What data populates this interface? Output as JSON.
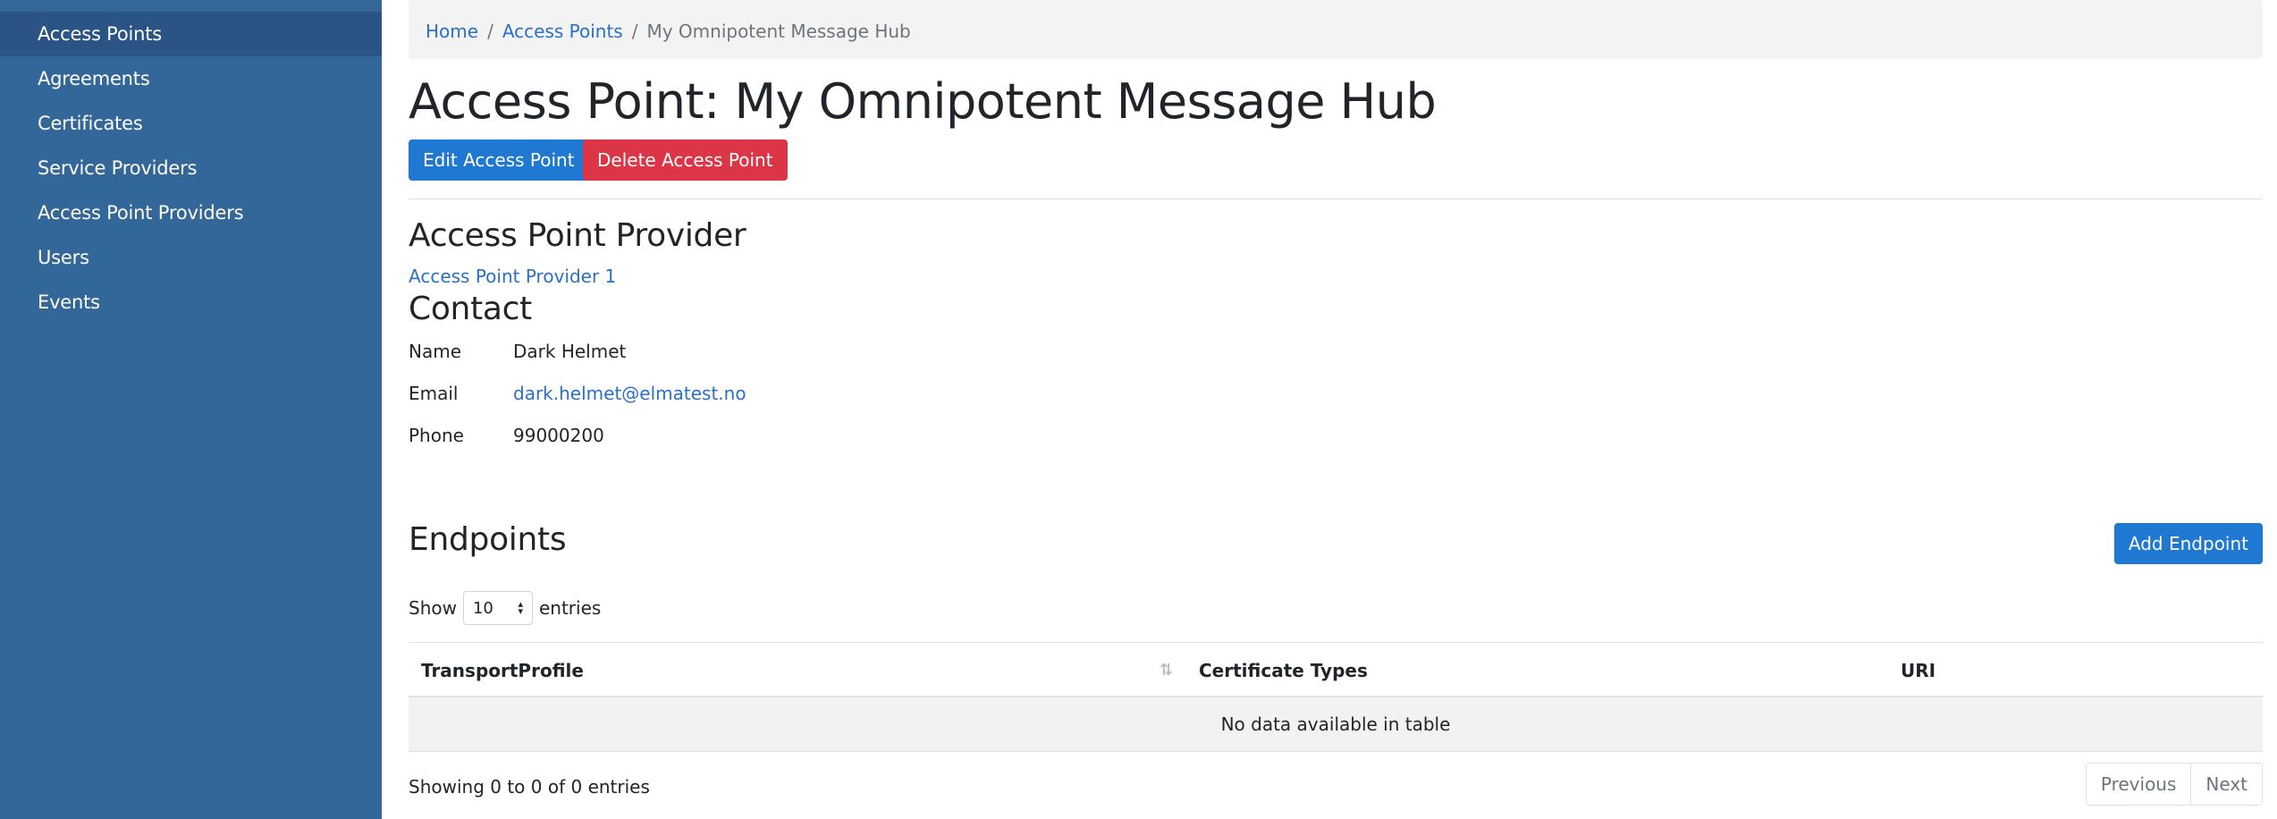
{
  "sidebar": {
    "items": [
      {
        "label": "Access Points",
        "active": true
      },
      {
        "label": "Agreements"
      },
      {
        "label": "Certificates"
      },
      {
        "label": "Service Providers"
      },
      {
        "label": "Access Point Providers"
      },
      {
        "label": "Users"
      },
      {
        "label": "Events"
      }
    ]
  },
  "breadcrumb": {
    "home": "Home",
    "separator": "/",
    "section": "Access Points",
    "current": "My Omnipotent Message Hub"
  },
  "page": {
    "title": "Access Point: My Omnipotent Message Hub",
    "edit_button": "Edit Access Point",
    "delete_button": "Delete Access Point"
  },
  "provider": {
    "heading": "Access Point Provider",
    "link": "Access Point Provider 1"
  },
  "contact": {
    "heading": "Contact",
    "name_label": "Name",
    "name_value": "Dark Helmet",
    "email_label": "Email",
    "email_value": "dark.helmet@elmatest.no",
    "phone_label": "Phone",
    "phone_value": "99000200"
  },
  "endpoints": {
    "heading": "Endpoints",
    "add_button": "Add Endpoint",
    "show_label": "Show",
    "page_size": "10",
    "entries_label": "entries",
    "columns": [
      "TransportProfile",
      "Certificate Types",
      "URI"
    ],
    "empty_message": "No data available in table",
    "info": "Showing 0 to 0 of 0 entries",
    "prev": "Previous",
    "next": "Next"
  },
  "colors": {
    "sidebar_bg": "#336699",
    "sidebar_active": "#2a5485",
    "primary": "#1f78d1",
    "danger": "#dc3545",
    "link": "#2a6fc9"
  }
}
